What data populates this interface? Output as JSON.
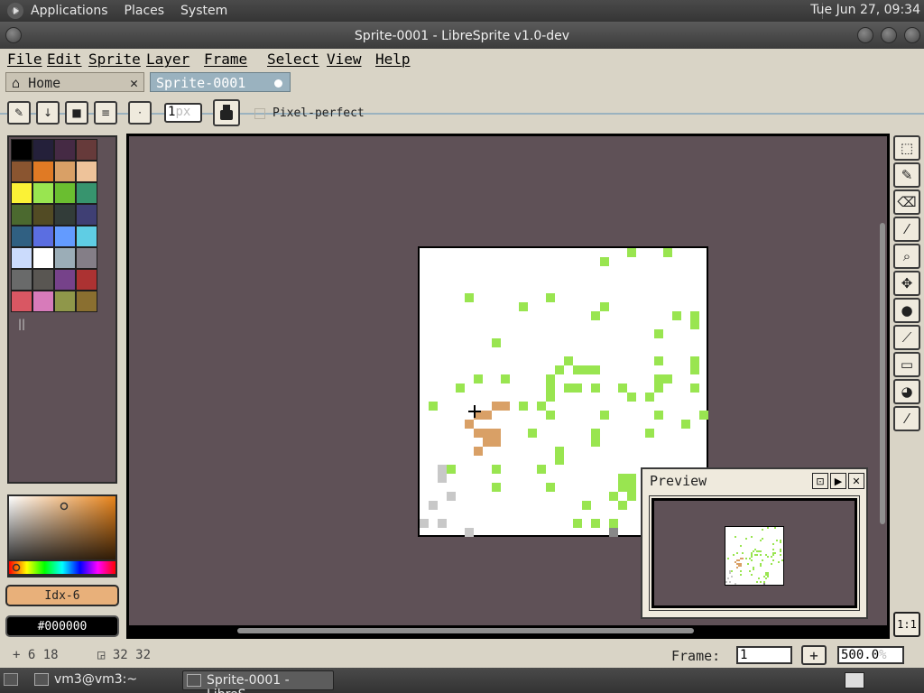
{
  "top_panel": {
    "menus": [
      "Applications",
      "Places",
      "System"
    ],
    "clock": "Tue Jun 27, 09:34"
  },
  "window": {
    "title": "Sprite-0001 - LibreSprite v1.0-dev"
  },
  "menubar": [
    "File",
    "Edit",
    "Sprite",
    "Layer",
    "Frame",
    "Select",
    "View",
    "Help"
  ],
  "tabs": [
    {
      "label": "Home"
    },
    {
      "label": "Sprite-0001"
    }
  ],
  "toolbar": {
    "brush_size_value": "1",
    "brush_size_unit": "px",
    "pixel_perfect_label": "Pixel-perfect"
  },
  "palette": {
    "colors": [
      "#000000",
      "#24203a",
      "#452a44",
      "#663a3a",
      "#8a5530",
      "#e07a24",
      "#d9a066",
      "#eec39a",
      "#fbf236",
      "#99e550",
      "#6abe30",
      "#37946e",
      "#4b692f",
      "#524b24",
      "#323c39",
      "#3f3f74",
      "#306082",
      "#5b6ee1",
      "#639bff",
      "#5fcde4",
      "#cbdbfc",
      "#ffffff",
      "#9badb7",
      "#847e87",
      "#696a6a",
      "#595652",
      "#76428a",
      "#ac3232",
      "#d95763",
      "#d77bba",
      "#8f974a",
      "#8a6f30"
    ]
  },
  "colors": {
    "foreground_label": "Idx-6",
    "background_label": "#000000"
  },
  "preview": {
    "title": "Preview"
  },
  "statusbar": {
    "position": "6 18",
    "size": "32 32",
    "frame_label": "Frame:",
    "frame_value": "1",
    "zoom": "500.0",
    "zoom_unit": "%"
  },
  "taskbar": {
    "tasks": [
      "vm3@vm3:~",
      "Sprite-0001 - LibreS..."
    ]
  },
  "tools_one_to_one": "1:1"
}
